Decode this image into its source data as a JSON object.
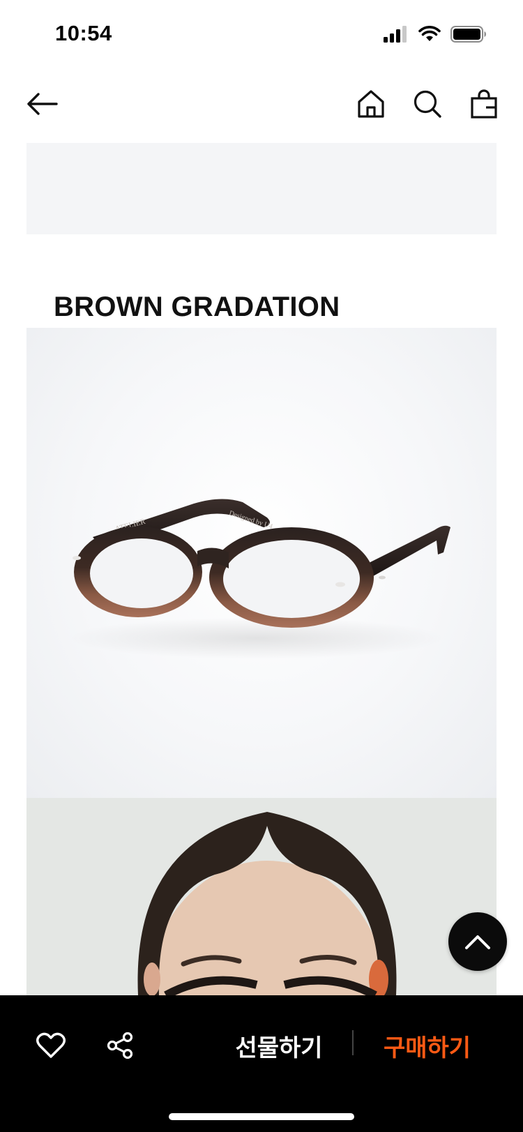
{
  "status_bar": {
    "time": "10:54"
  },
  "nav": {
    "icons": [
      "back-arrow-icon",
      "home-icon",
      "search-icon",
      "shopping-bag-icon"
    ]
  },
  "product": {
    "color_title": "BROWN GRADATION",
    "temple_text_left": "ATELIER",
    "temple_text_right": "Designed by U4",
    "frame_colors": {
      "top": "#2b2220",
      "bottom": "#a8715a"
    }
  },
  "bottom_bar": {
    "gift_label": "선물하기",
    "buy_label": "구매하기",
    "buy_color": "#ff5a14",
    "icons": [
      "heart-icon",
      "share-icon"
    ]
  },
  "scroll_top": {
    "icon": "chevron-up-icon"
  }
}
